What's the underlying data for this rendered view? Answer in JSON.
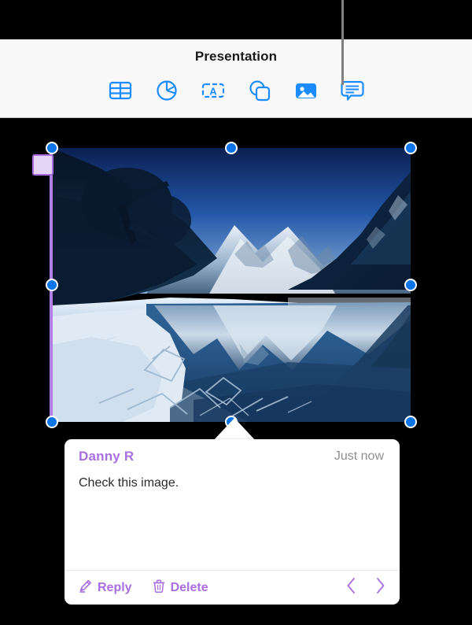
{
  "app": {
    "title": "Presentation",
    "background_color": "#000000",
    "toolbar_bg": "#f8f8f8",
    "accent_blue": "#0a74e8",
    "accent_purple": "#a96fe0"
  },
  "callout": {
    "name": "annotation-leader-line",
    "color": "#808080"
  },
  "toolbar": {
    "title": "Presentation",
    "buttons": [
      {
        "name": "table-icon",
        "label": "Table"
      },
      {
        "name": "chart-icon",
        "label": "Chart"
      },
      {
        "name": "text-icon",
        "label": "Text"
      },
      {
        "name": "shape-icon",
        "label": "Shape"
      },
      {
        "name": "media-icon",
        "label": "Media"
      },
      {
        "name": "comment-icon",
        "label": "Comment"
      }
    ]
  },
  "canvas": {
    "image": {
      "name": "winter-lake-photo",
      "alt": "Snow covered mountains reflected in a still alpine lake",
      "selected": true
    },
    "selection": {
      "handle_color": "#0a74e8",
      "handle_border": "#ffffff",
      "handles": [
        "top-left",
        "top-center",
        "top-right",
        "middle-left",
        "middle-right",
        "bottom-left",
        "bottom-center",
        "bottom-right"
      ]
    },
    "comment_marker": {
      "name": "comment-anchor-marker",
      "fill": "#e6d4f7",
      "border": "#a96fe0"
    }
  },
  "comment_popup": {
    "author": "Danny R",
    "timestamp": "Just now",
    "body": "Check this image.",
    "actions": [
      {
        "name": "reply-button",
        "label": "Reply",
        "icon": "pencil-icon"
      },
      {
        "name": "delete-button",
        "label": "Delete",
        "icon": "trash-icon"
      }
    ],
    "navigation": {
      "previous": "‹",
      "next": "›"
    }
  }
}
